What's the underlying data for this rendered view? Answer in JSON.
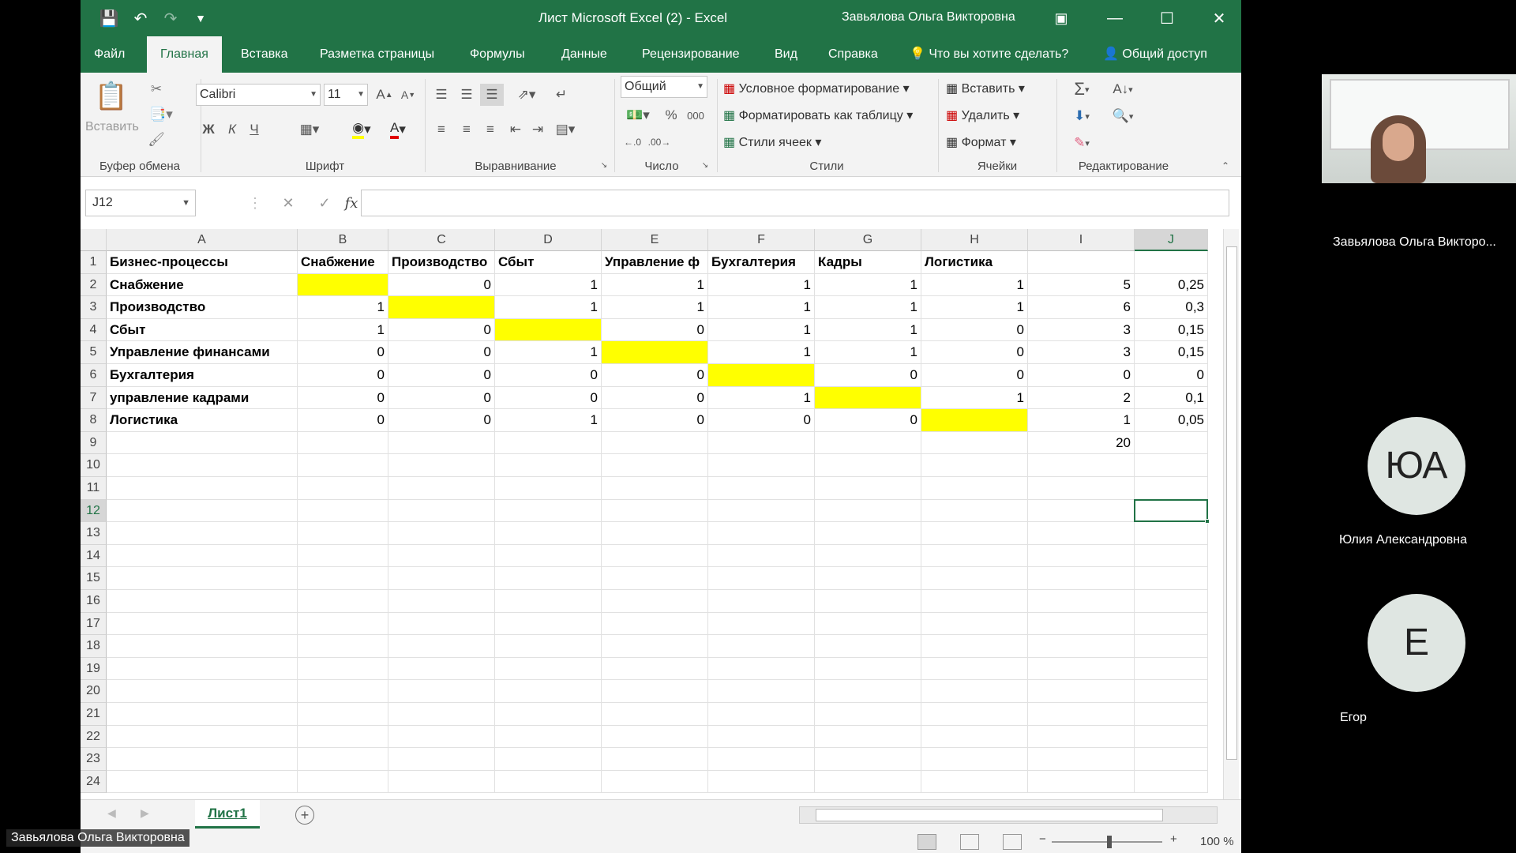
{
  "window": {
    "title": "Лист Microsoft Excel (2)  -  Excel",
    "user": "Завьялова Ольга Викторовна"
  },
  "tabs": [
    "Файл",
    "Главная",
    "Вставка",
    "Разметка страницы",
    "Формулы",
    "Данные",
    "Рецензирование",
    "Вид",
    "Справка"
  ],
  "tell_me": "Что вы хотите сделать?",
  "share": "Общий доступ",
  "ribbon": {
    "paste": "Вставить",
    "font_name": "Calibri",
    "font_size": "11",
    "bold": "Ж",
    "italic": "К",
    "underline": "Ч",
    "number_format": "Общий",
    "percent": "%",
    "thousands": "000",
    "cond_format": "Условное форматирование",
    "format_table": "Форматировать как таблицу",
    "cell_styles": "Стили ячеек",
    "insert": "Вставить",
    "delete": "Удалить",
    "format": "Формат",
    "groups": {
      "clipboard": "Буфер обмена",
      "font": "Шрифт",
      "alignment": "Выравнивание",
      "number": "Число",
      "styles": "Стили",
      "cells": "Ячейки",
      "editing": "Редактирование"
    }
  },
  "formula_bar": {
    "name_box": "J12",
    "fx": "fx",
    "formula": ""
  },
  "sheet": {
    "columns": [
      "A",
      "B",
      "C",
      "D",
      "E",
      "F",
      "G",
      "H",
      "I",
      "J"
    ],
    "selected_column": "J",
    "selected_row": 12,
    "selected_cell": "J12",
    "row_numbers": [
      "1",
      "2",
      "3",
      "4",
      "5",
      "6",
      "7",
      "8",
      "9",
      "10",
      "11",
      "12",
      "13",
      "14",
      "15",
      "16",
      "17",
      "18",
      "19",
      "20",
      "21",
      "22",
      "23",
      "24"
    ],
    "rows": [
      [
        "Бизнес-процессы",
        "Снабжение",
        "Производство",
        "Сбыт",
        "Управление ф",
        "Бухгалтерия",
        "Кадры",
        "Логистика",
        "",
        ""
      ],
      [
        "Снабжение",
        "",
        "0",
        "1",
        "1",
        "1",
        "1",
        "1",
        "5",
        "0,25"
      ],
      [
        "Производство",
        "1",
        "",
        "1",
        "1",
        "1",
        "1",
        "1",
        "6",
        "0,3"
      ],
      [
        "Сбыт",
        "1",
        "0",
        "",
        "0",
        "1",
        "1",
        "0",
        "3",
        "0,15"
      ],
      [
        "Управление финансами",
        "0",
        "0",
        "1",
        "",
        "1",
        "1",
        "0",
        "3",
        "0,15"
      ],
      [
        "Бухгалтерия",
        "0",
        "0",
        "0",
        "0",
        "",
        "0",
        "0",
        "0",
        "0"
      ],
      [
        "управление кадрами",
        "0",
        "0",
        "0",
        "0",
        "1",
        "",
        "1",
        "2",
        "0,1"
      ],
      [
        "Логистика",
        "0",
        "0",
        "1",
        "0",
        "0",
        "0",
        "",
        "1",
        "0,05"
      ],
      [
        "",
        "",
        "",
        "",
        "",
        "",
        "",
        "",
        "20",
        ""
      ]
    ],
    "highlight_color": "#ffff00",
    "tab_name": "Лист1"
  },
  "status": {
    "zoom": "100 %"
  },
  "call": {
    "self_name": "Завьялова Ольга Викторо...",
    "participants": [
      {
        "initials": "ЮА",
        "name": "Юлия Александровна"
      },
      {
        "initials": "Е",
        "name": "Егор"
      }
    ],
    "bottom_name": "Завьялова Ольга Викторовна"
  },
  "colors": {
    "excel_green": "#217346",
    "ribbon_bg": "#f3f3f3",
    "highlight": "#ffff00"
  }
}
